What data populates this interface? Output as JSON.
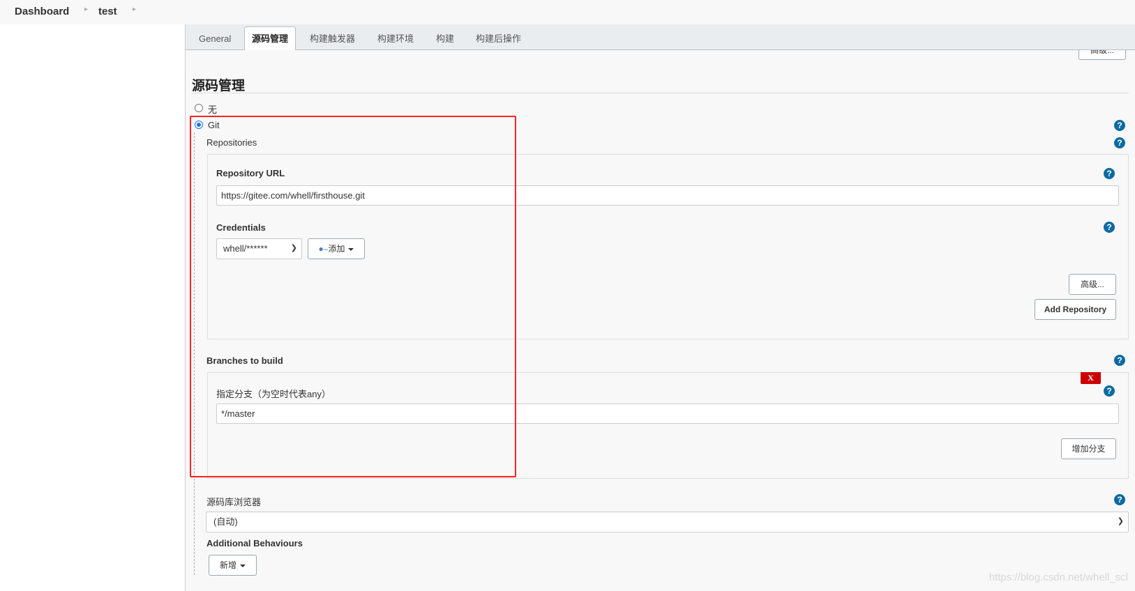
{
  "breadcrumb": [
    "Dashboard",
    "test"
  ],
  "tabs": [
    {
      "label": "General"
    },
    {
      "label": "源码管理",
      "active": true
    },
    {
      "label": "构建触发器"
    },
    {
      "label": "构建环境"
    },
    {
      "label": "构建"
    },
    {
      "label": "构建后操作"
    }
  ],
  "top_advanced": "高级...",
  "section": {
    "title": "源码管理",
    "none_label": "无",
    "git_label": "Git",
    "selected": "Git"
  },
  "git": {
    "repositories_label": "Repositories",
    "repo_url_label": "Repository URL",
    "repo_url": "https://gitee.com/whell/firsthouse.git",
    "credentials_label": "Credentials",
    "credentials_value": "whell/******",
    "add_label": "添加",
    "advanced_label": "高级...",
    "add_repo_label": "Add Repository",
    "branches_label": "Branches to build",
    "delete_label": "X",
    "branch_spec_label": "指定分支（为空时代表any）",
    "branch_spec": "*/master",
    "add_branch_label": "增加分支",
    "browser_label": "源码库浏览器",
    "browser_value": "(自动)",
    "behaviours_label": "Additional Behaviours",
    "new_label": "新增"
  },
  "help_symbol": "?",
  "watermark": "https://blog.csdn.net/whell_scl",
  "colors": {
    "accent": "#0b6aa2",
    "highlight": "#ff2222",
    "delete": "#cc0000"
  }
}
